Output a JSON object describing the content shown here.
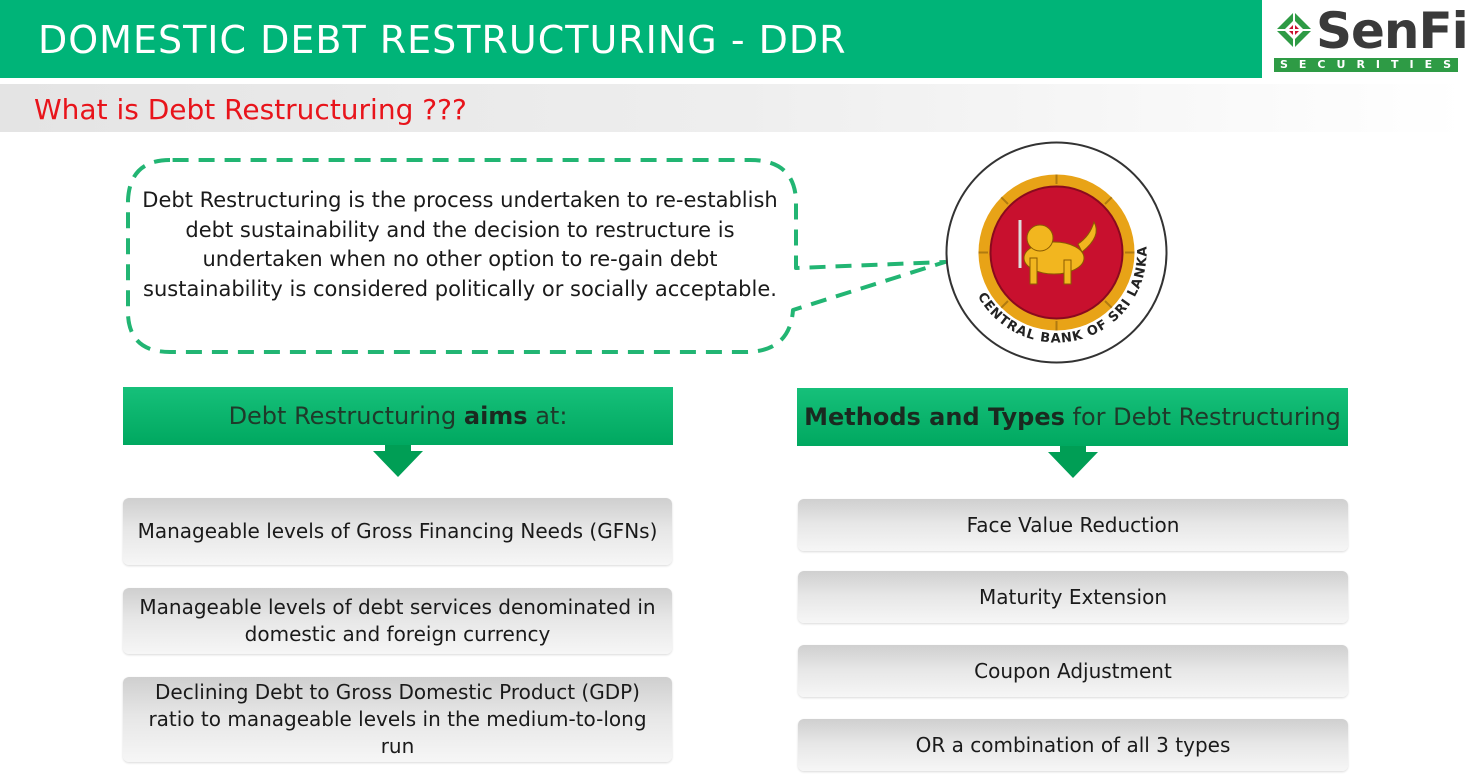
{
  "header": {
    "title": "DOMESTIC DEBT RESTRUCTURING - DDR",
    "logo_word_1": "Sen",
    "logo_word_2": "Fin",
    "logo_tagline": "SECURITIES"
  },
  "subtitle": "What is Debt Restructuring ???",
  "definition": "Debt Restructuring is the process undertaken to re-establish debt sustainability and the decision to restructure is undertaken when no other option to re-gain debt sustainability is considered politically or socially acceptable.",
  "seal": {
    "text_english": "CENTRAL BANK OF SRI LANKA"
  },
  "aims": {
    "header_pre": "Debt Restructuring ",
    "header_bold": "aims",
    "header_post": " at:",
    "items": [
      "Manageable levels of Gross Financing Needs (GFNs)",
      "Manageable levels of debt services denominated in domestic and foreign currency",
      "Declining Debt to Gross Domestic Product (GDP) ratio to manageable levels in the medium-to-long run"
    ]
  },
  "methods": {
    "header_bold": "Methods and Types",
    "header_post": " for Debt Restructuring",
    "items": [
      "Face Value Reduction",
      "Maturity Extension",
      "Coupon Adjustment",
      "OR a combination of all 3 types"
    ]
  },
  "colors": {
    "brand_green": "#00b478",
    "subtitle_red": "#e8141b",
    "seal_red": "#c8102e",
    "seal_gold": "#e8a317"
  }
}
